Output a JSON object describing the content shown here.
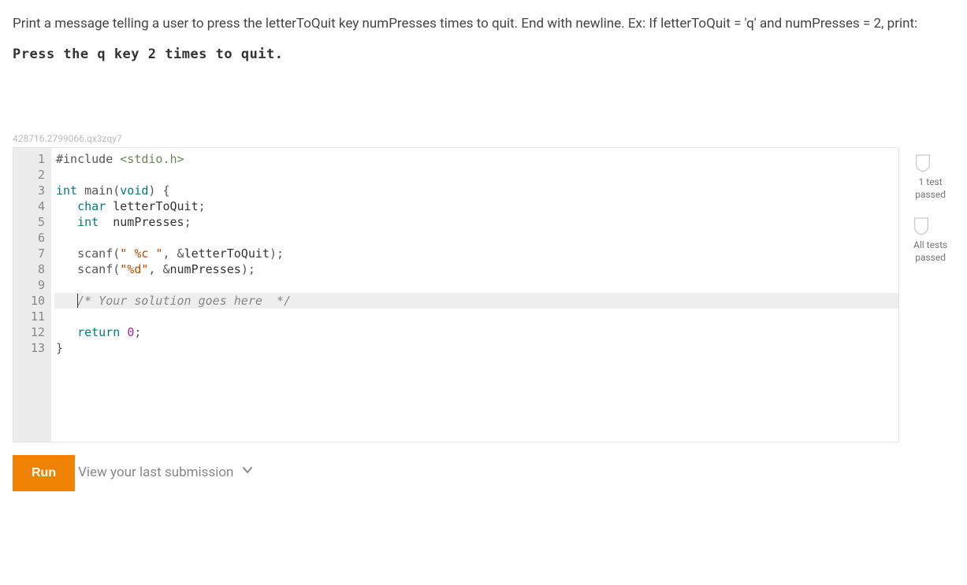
{
  "problem": {
    "instructions": "Print a message telling a user to press the letterToQuit key numPresses times to quit. End with newline. Ex: If letterToQuit = 'q' and numPresses = 2, print:",
    "example_output": "Press the q key 2 times to quit."
  },
  "editor": {
    "id": "428716.2799066.qx3zqy7",
    "highlight_line": 10,
    "lines": [
      {
        "n": 1,
        "tokens": [
          [
            "include",
            "#include "
          ],
          [
            "header",
            "<stdio.h>"
          ]
        ]
      },
      {
        "n": 2,
        "tokens": []
      },
      {
        "n": 3,
        "tokens": [
          [
            "keyword",
            "int "
          ],
          [
            "fn",
            "main"
          ],
          [
            "punct",
            "("
          ],
          [
            "keyword",
            "void"
          ],
          [
            "punct",
            ") {"
          ]
        ]
      },
      {
        "n": 4,
        "tokens": [
          [
            "plain",
            "   "
          ],
          [
            "keyword",
            "char "
          ],
          [
            "ident",
            "letterToQuit"
          ],
          [
            "punct",
            ";"
          ]
        ]
      },
      {
        "n": 5,
        "tokens": [
          [
            "plain",
            "   "
          ],
          [
            "keyword",
            "int  "
          ],
          [
            "ident",
            "numPresses"
          ],
          [
            "punct",
            ";"
          ]
        ]
      },
      {
        "n": 6,
        "tokens": []
      },
      {
        "n": 7,
        "tokens": [
          [
            "plain",
            "   "
          ],
          [
            "fn",
            "scanf"
          ],
          [
            "punct",
            "("
          ],
          [
            "str",
            "\" %c \""
          ],
          [
            "punct",
            ", &"
          ],
          [
            "ident",
            "letterToQuit"
          ],
          [
            "punct",
            ");"
          ]
        ]
      },
      {
        "n": 8,
        "tokens": [
          [
            "plain",
            "   "
          ],
          [
            "fn",
            "scanf"
          ],
          [
            "punct",
            "("
          ],
          [
            "str",
            "\"%d\""
          ],
          [
            "punct",
            ", &"
          ],
          [
            "ident",
            "numPresses"
          ],
          [
            "punct",
            ");"
          ]
        ]
      },
      {
        "n": 9,
        "tokens": []
      },
      {
        "n": 10,
        "tokens": [
          [
            "plain",
            "   "
          ],
          [
            "cursor",
            ""
          ],
          [
            "comment",
            "/* Your solution goes here  */"
          ]
        ]
      },
      {
        "n": 11,
        "tokens": []
      },
      {
        "n": 12,
        "tokens": [
          [
            "plain",
            "   "
          ],
          [
            "keyword",
            "return "
          ],
          [
            "num",
            "0"
          ],
          [
            "punct",
            ";"
          ]
        ]
      },
      {
        "n": 13,
        "tokens": [
          [
            "punct",
            "}"
          ]
        ]
      }
    ]
  },
  "status": {
    "items": [
      {
        "label_line1": "1 test",
        "label_line2": "passed"
      },
      {
        "label_line1": "All tests",
        "label_line2": "passed"
      }
    ]
  },
  "buttons": {
    "run": "Run"
  },
  "links": {
    "view_last": "View your last submission"
  }
}
